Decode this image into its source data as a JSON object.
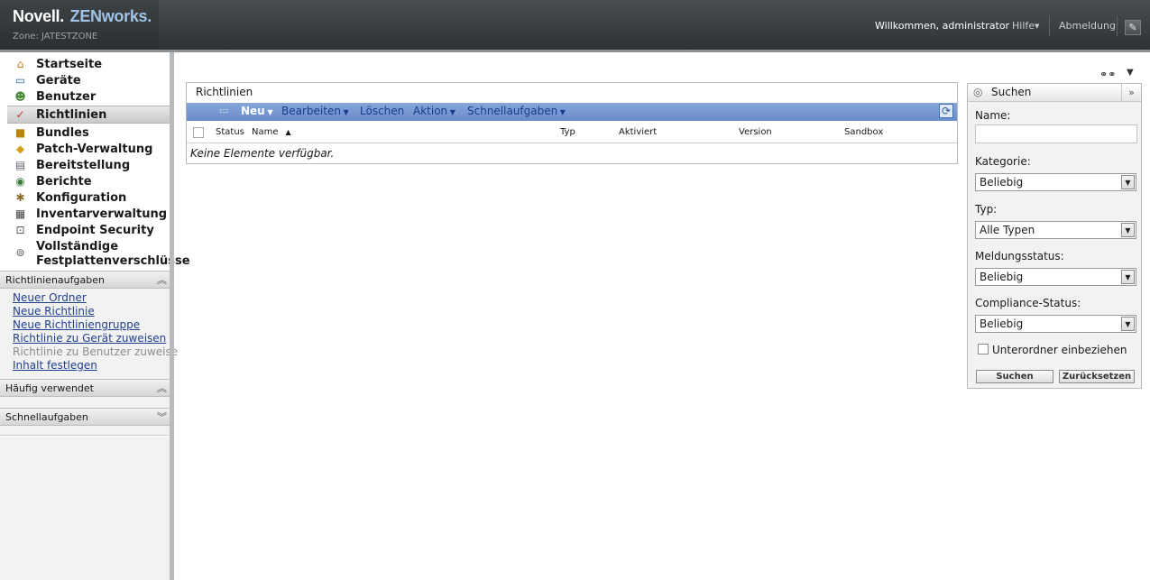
{
  "header": {
    "brand_novell": "Novell.",
    "brand_product": "ZENworks.",
    "zone": "Zone: JATESTZONE",
    "welcome": "Willkommen, administrator",
    "help": "Hilfe",
    "logout": "Abmeldung"
  },
  "nav": {
    "items": [
      {
        "label": "Startseite",
        "icon": "home-icon"
      },
      {
        "label": "Geräte",
        "icon": "devices-icon"
      },
      {
        "label": "Benutzer",
        "icon": "users-icon"
      },
      {
        "label": "Richtlinien",
        "icon": "policies-icon",
        "active": true
      },
      {
        "label": "Bundles",
        "icon": "bundles-icon"
      },
      {
        "label": "Patch-Verwaltung",
        "icon": "patch-icon"
      },
      {
        "label": "Bereitstellung",
        "icon": "deployment-icon"
      },
      {
        "label": "Berichte",
        "icon": "reports-icon"
      },
      {
        "label": "Konfiguration",
        "icon": "configuration-icon"
      },
      {
        "label": "Inventarverwaltung",
        "icon": "inventory-icon"
      },
      {
        "label": "Endpoint Security",
        "icon": "endpoint-security-icon"
      },
      {
        "label": "Vollständige",
        "label2": "Festplattenverschlüsse",
        "icon": "disk-encryption-icon"
      }
    ]
  },
  "sections": {
    "policy_tasks": {
      "title": "Richtlinienaufgaben",
      "links": [
        {
          "label": "Neuer Ordner"
        },
        {
          "label": "Neue Richtlinie"
        },
        {
          "label": "Neue Richtliniengruppe"
        },
        {
          "label": "Richtlinie zu Gerät zuweisen"
        },
        {
          "label": "Richtlinie zu Benutzer zuweise",
          "disabled": true
        },
        {
          "label": "Inhalt festlegen"
        }
      ]
    },
    "frequent": {
      "title": "Häufig verwendet"
    },
    "quick": {
      "title": "Schnellaufgaben"
    }
  },
  "main": {
    "panel_title": "Richtlinien",
    "toolbar": {
      "new": "Neu",
      "edit": "Bearbeiten",
      "delete": "Löschen",
      "action": "Aktion",
      "quick": "Schnellaufgaben"
    },
    "columns": [
      "Status",
      "Name",
      "Typ",
      "Aktiviert",
      "Version",
      "Sandbox"
    ],
    "sort_column": "Name",
    "empty_message": "Keine Elemente verfügbar."
  },
  "search": {
    "title": "Suchen",
    "name_label": "Name:",
    "name_value": "",
    "category_label": "Kategorie:",
    "category_value": "Beliebig",
    "type_label": "Typ:",
    "type_value": "Alle Typen",
    "message_label": "Meldungsstatus:",
    "message_value": "Beliebig",
    "compliance_label": "Compliance-Status:",
    "compliance_value": "Beliebig",
    "subfolders_label": "Unterordner einbeziehen",
    "subfolders_checked": false,
    "search_button": "Suchen",
    "reset_button": "Zurücksetzen"
  },
  "colors": {
    "toolbar": "#7398d2",
    "link": "#1f3f8f",
    "header": "#3a3f42"
  }
}
